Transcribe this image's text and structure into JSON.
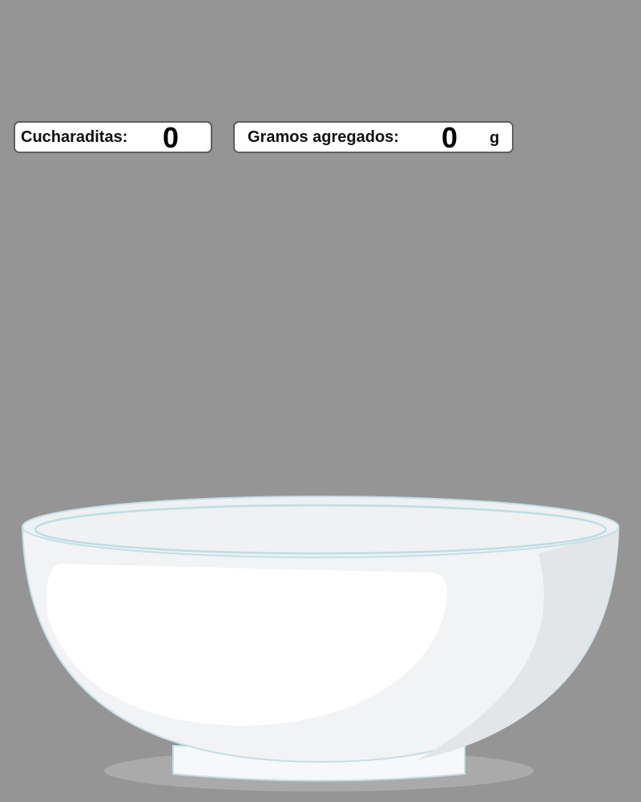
{
  "counters": {
    "teaspoons": {
      "label": "Cucharaditas:",
      "value": "0"
    },
    "grams": {
      "label": "Gramos agregados:",
      "value": "0",
      "unit": "g"
    }
  },
  "bowl": {
    "icon": "bowl-icon",
    "state": "empty"
  },
  "colors": {
    "background": "#959595",
    "panel": "#ffffff",
    "panel_border": "#5e5e5e",
    "bowl_body": "#f2f3f4",
    "bowl_outline": "#c4dfe6",
    "shadow": "#aaaaaa"
  }
}
